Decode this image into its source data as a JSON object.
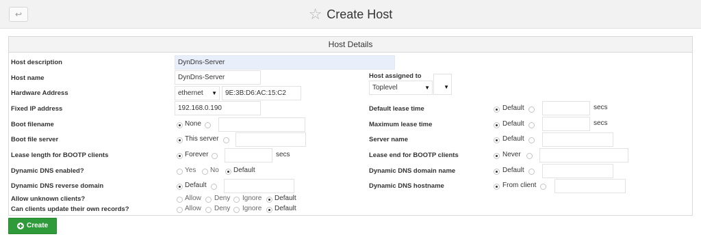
{
  "header": {
    "title": "Create Host",
    "back_icon": "↩"
  },
  "panel": {
    "title": "Host Details"
  },
  "fields": {
    "host_description": {
      "label": "Host description",
      "value": "DynDns-Server"
    },
    "host_name": {
      "label": "Host name",
      "value": "DynDns-Server"
    },
    "hardware_address": {
      "label": "Hardware Address",
      "type_value": "ethernet",
      "value": "9E:3B:D6:AC:15:C2"
    },
    "fixed_ip": {
      "label": "Fixed IP address",
      "value": "192.168.0.190"
    },
    "boot_filename": {
      "label": "Boot filename",
      "opt1": "None",
      "value": ""
    },
    "boot_file_server": {
      "label": "Boot file server",
      "opt1": "This server",
      "value": ""
    },
    "lease_length_bootp": {
      "label": "Lease length for BOOTP clients",
      "opt1": "Forever",
      "unit": "secs",
      "value": ""
    },
    "ddns_enabled": {
      "label": "Dynamic DNS enabled?",
      "opt1": "Yes",
      "opt2": "No",
      "opt3": "Default"
    },
    "ddns_reverse_domain": {
      "label": "Dynamic DNS reverse domain",
      "opt1": "Default",
      "value": ""
    },
    "allow_unknown": {
      "label": "Allow unknown clients?",
      "opt1": "Allow",
      "opt2": "Deny",
      "opt3": "Ignore",
      "opt4": "Default"
    },
    "clients_update": {
      "label": "Can clients update their own records?",
      "opt1": "Allow",
      "opt2": "Deny",
      "opt3": "Ignore",
      "opt4": "Default"
    },
    "host_assigned_to": {
      "label": "Host assigned to",
      "value": "Toplevel"
    },
    "default_lease_time": {
      "label": "Default lease time",
      "opt1": "Default",
      "unit": "secs",
      "value": ""
    },
    "max_lease_time": {
      "label": "Maximum lease time",
      "opt1": "Default",
      "unit": "secs",
      "value": ""
    },
    "server_name": {
      "label": "Server name",
      "opt1": "Default",
      "value": ""
    },
    "lease_end_bootp": {
      "label": "Lease end for BOOTP clients",
      "opt1": "Never",
      "value": ""
    },
    "ddns_domain_name": {
      "label": "Dynamic DNS domain name",
      "opt1": "Default",
      "value": ""
    },
    "ddns_hostname": {
      "label": "Dynamic DNS hostname",
      "opt1": "From client",
      "value": ""
    }
  },
  "actions": {
    "create_label": "Create"
  },
  "colors": {
    "accent_green": "#2e9a3a",
    "highlight_input": "#e8eefa"
  }
}
